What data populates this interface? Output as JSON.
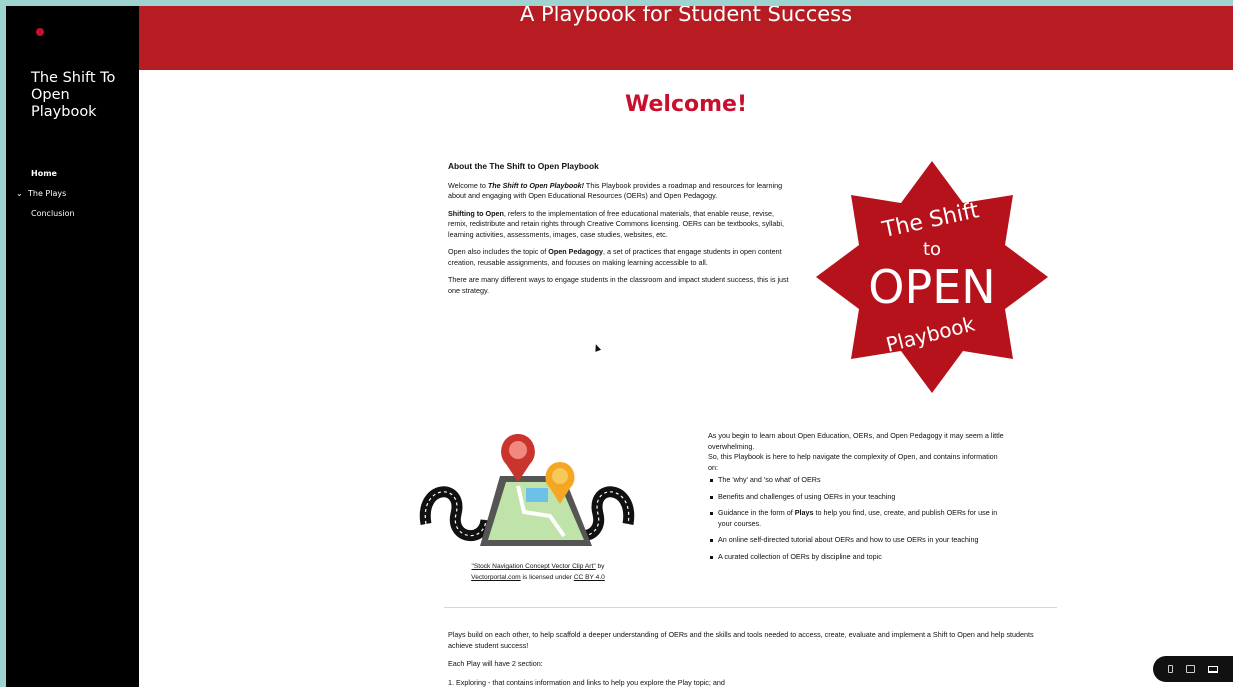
{
  "sidebar": {
    "site_title": "The Shift To Open Playbook",
    "nav": [
      {
        "label": "Home"
      },
      {
        "label": "The Plays"
      },
      {
        "label": "Conclusion"
      }
    ]
  },
  "header": {
    "title": "A Playbook for Student Success"
  },
  "main": {
    "welcome": "Welcome!",
    "about": {
      "heading": "About the The Shift to Open Playbook",
      "p1_pre": "Welcome to ",
      "p1_em": "The Shift to Open Playbook!",
      "p1_post": " This Playbook provides a roadmap and resources for learning about and engaging with Open Educational Resources (OERs) and Open Pedagogy.",
      "p2_strong": "Shifting to Open",
      "p2_post": ", refers to the implementation of free educational materials, that enable reuse, revise, remix, redistribute and retain rights through Creative Commons licensing. OERs can be textbooks, syllabi, learning activities, assessments, images, case studies, websites, etc.",
      "p3_pre": "Open also includes the topic of ",
      "p3_strong": "Open Pedagogy",
      "p3_post": ", a set of practices that engage students in open content creation, reusable assignments, and focuses on making learning accessible to all.",
      "p4": "There are many different ways to engage students in the classroom and impact student success, this is just one strategy."
    },
    "badge": {
      "line1": "The Shift",
      "line2": "to",
      "line3": "OPEN",
      "line4": "Playbook",
      "color": "#b5121b"
    },
    "image_credit": {
      "link1": "\"Stock Navigation Concept Vector Clip Art\"",
      "by": " by ",
      "link2": "Vectorportal.com",
      "licensed": " is licensed under ",
      "link3": "CC BY 4.0"
    },
    "intro": {
      "line1": "As you begin to learn about Open Education, OERs, and Open Pedagogy it may seem a little overwhelming.",
      "line2": "So, this Playbook is here to help navigate the complexity of Open, and contains information on:",
      "items": [
        "The 'why' and 'so what' of OERs",
        "Benefits and challenges of using OERs in your teaching",
        "An online self-directed tutorial about OERs and how to use OERs in your teaching",
        "A curated collection of OERs by discipline and topic"
      ],
      "guidance_pre": "Guidance in the form of ",
      "guidance_strong": "Plays",
      "guidance_post": " to help you find, use, create, and publish OERs for use in your courses."
    },
    "plays": {
      "p1": "Plays build on each other, to help scaffold a deeper understanding of OERs and the skills and tools needed to access, create, evaluate and implement a Shift to Open and help students achieve student success!",
      "p2": "Each Play will have 2 section:",
      "p3": "1. Exploring - that contains information and links to help you explore the Play topic; and"
    }
  },
  "colors": {
    "header_red": "#b71c22",
    "accent_red": "#c8102e",
    "sidebar": "#000000"
  }
}
